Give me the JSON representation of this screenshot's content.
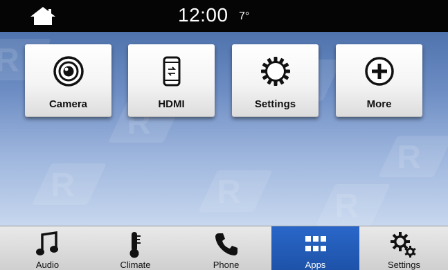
{
  "status_bar": {
    "time": "12:00",
    "temperature": "7°",
    "home_icon": "home-icon"
  },
  "apps": [
    {
      "label": "Camera",
      "icon": "camera-lens-icon"
    },
    {
      "label": "HDMI",
      "icon": "hdmi-phone-icon"
    },
    {
      "label": "Settings",
      "icon": "gear-icon"
    },
    {
      "label": "More",
      "icon": "plus-circle-icon"
    }
  ],
  "bottom_nav": {
    "active": "Apps",
    "items": [
      {
        "label": "Audio",
        "icon": "music-note-icon"
      },
      {
        "label": "Climate",
        "icon": "thermometer-icon"
      },
      {
        "label": "Phone",
        "icon": "phone-handset-icon"
      },
      {
        "label": "Apps",
        "icon": "apps-grid-icon"
      },
      {
        "label": "Settings",
        "icon": "gears-icon"
      }
    ]
  },
  "colors": {
    "status_bar_bg": "#050505",
    "background_top": "#4f73ad",
    "background_bottom": "#c7d7ee",
    "active_nav_bg": "#2060c0"
  }
}
